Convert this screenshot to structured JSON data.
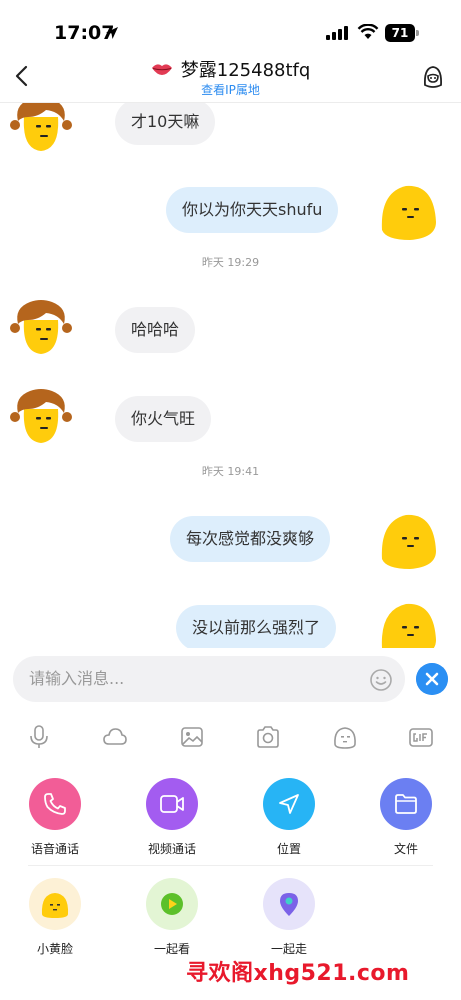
{
  "status_bar": {
    "time": "17:07",
    "battery": "71"
  },
  "header": {
    "back_icon": "chevron-left-icon",
    "title": "梦露125488tfq",
    "subtitle": "查看IP属地",
    "profile_icon": "user-profile-icon"
  },
  "messages": [
    {
      "side": "in",
      "text": "才10天嘛",
      "avatar": "girl"
    },
    {
      "side": "out",
      "text": "你以为你天天shufu",
      "avatar": "blob"
    },
    {
      "side": "in",
      "text": "哈哈哈",
      "avatar": "girl"
    },
    {
      "side": "in",
      "text": "你火气旺",
      "avatar": "girl"
    },
    {
      "side": "out",
      "text": "每次感觉都没爽够",
      "avatar": "blob"
    },
    {
      "side": "out",
      "text": "没以前那么强烈了",
      "avatar": "blob"
    }
  ],
  "timestamps": [
    "昨天 19:29",
    "昨天 19:41"
  ],
  "input": {
    "placeholder": "请输入消息..."
  },
  "toolbar": [
    "microphone-icon",
    "cloud-icon",
    "image-icon",
    "camera-icon",
    "sticker-icon",
    "gif-icon"
  ],
  "features_row1": [
    {
      "label": "语音通话",
      "icon": "phone-icon",
      "color": "#f25d97"
    },
    {
      "label": "视频通话",
      "icon": "video-icon",
      "color": "#a35cf0"
    },
    {
      "label": "位置",
      "icon": "location-arrow-icon",
      "color": "#27b4f5"
    },
    {
      "label": "文件",
      "icon": "folder-icon",
      "color": "#6b7ff2"
    }
  ],
  "features_row2": [
    {
      "label": "小黄脸",
      "icon": "yellow-face-icon",
      "color": "#fdf1d6"
    },
    {
      "label": "一起看",
      "icon": "play-icon",
      "color": "#e3f5d4"
    },
    {
      "label": "一起走",
      "icon": "map-pin-icon",
      "color": "#e6e3fa"
    }
  ],
  "watermark": "寻欢阁xhg521.com"
}
